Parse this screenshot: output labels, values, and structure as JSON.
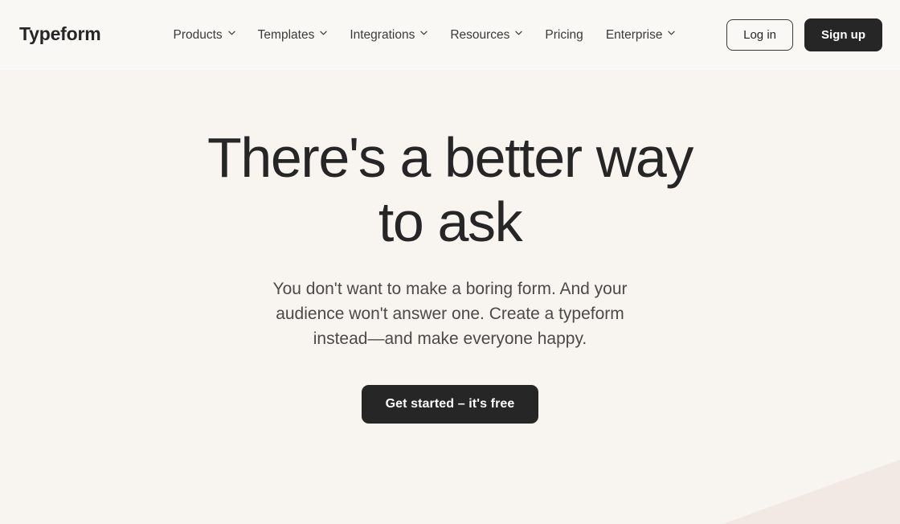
{
  "header": {
    "brand": "Typeform",
    "nav": [
      {
        "label": "Products",
        "has_chevron": true,
        "icon": "chevron-down-icon"
      },
      {
        "label": "Templates",
        "has_chevron": true,
        "icon": "chevron-down-icon"
      },
      {
        "label": "Integrations",
        "has_chevron": true,
        "icon": "chevron-down-icon"
      },
      {
        "label": "Resources",
        "has_chevron": true,
        "icon": "chevron-down-icon"
      },
      {
        "label": "Pricing",
        "has_chevron": false,
        "icon": ""
      },
      {
        "label": "Enterprise",
        "has_chevron": true,
        "icon": "chevron-down-icon"
      }
    ],
    "login_label": "Log in",
    "signup_label": "Sign up"
  },
  "hero": {
    "title": "There's a better way to ask",
    "subtitle": "You don't want to make a boring form. And your audience won't answer one. Create a typeform instead—and make everyone happy.",
    "cta_label": "Get started – it's free"
  },
  "colors": {
    "page_background": "#F8F5F1",
    "header_background": "#FAF8F5",
    "text_primary": "#262627",
    "text_secondary": "#4A4A48",
    "button_dark": "#262627",
    "button_dark_text": "#FFFFFF",
    "corner_wedge": "#F2E9E4"
  }
}
